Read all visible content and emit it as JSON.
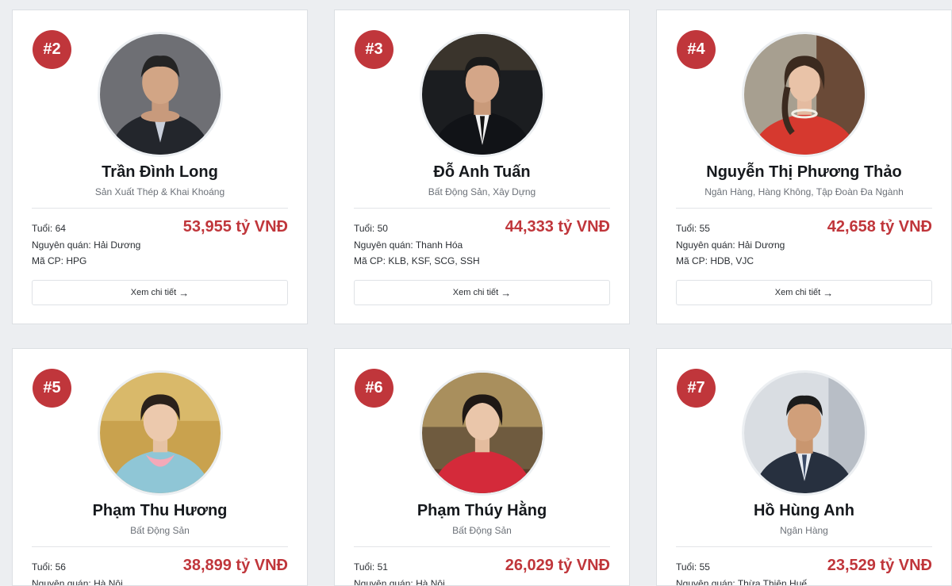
{
  "labels": {
    "age": "Tuổi: ",
    "hometown": "Nguyên quán: ",
    "stock": "Mã CP: ",
    "detail": "Xem chi tiết"
  },
  "colors": {
    "accent": "#c0363b",
    "background": "#eceef1"
  },
  "cards": [
    {
      "rank": "#2",
      "name": "Trần Đình Long",
      "industry": "Sản Xuất Thép & Khai Khoáng",
      "age": "64",
      "hometown": "Hải Dương",
      "stock": "HPG",
      "wealth": "53,955 tỷ VNĐ"
    },
    {
      "rank": "#3",
      "name": "Đỗ Anh Tuấn",
      "industry": "Bất Động Sản, Xây Dựng",
      "age": "50",
      "hometown": "Thanh Hóa",
      "stock": "KLB, KSF, SCG, SSH",
      "wealth": "44,333 tỷ VNĐ"
    },
    {
      "rank": "#4",
      "name": "Nguyễn Thị Phương Thảo",
      "industry": "Ngân Hàng, Hàng Không, Tập Đoàn Đa Ngành",
      "age": "55",
      "hometown": "Hải Dương",
      "stock": "HDB, VJC",
      "wealth": "42,658 tỷ VNĐ"
    },
    {
      "rank": "#5",
      "name": "Phạm Thu Hương",
      "industry": "Bất Động Sản",
      "age": "56",
      "hometown": "Hà Nội",
      "wealth": "38,899 tỷ VNĐ"
    },
    {
      "rank": "#6",
      "name": "Phạm Thúy Hằng",
      "industry": "Bất Động Sản",
      "age": "51",
      "hometown": "Hà Nội",
      "wealth": "26,029 tỷ VNĐ"
    },
    {
      "rank": "#7",
      "name": "Hồ Hùng Anh",
      "industry": "Ngân Hàng",
      "age": "55",
      "hometown": "Thừa Thiên Huế",
      "wealth": "23,529 tỷ VNĐ"
    }
  ]
}
